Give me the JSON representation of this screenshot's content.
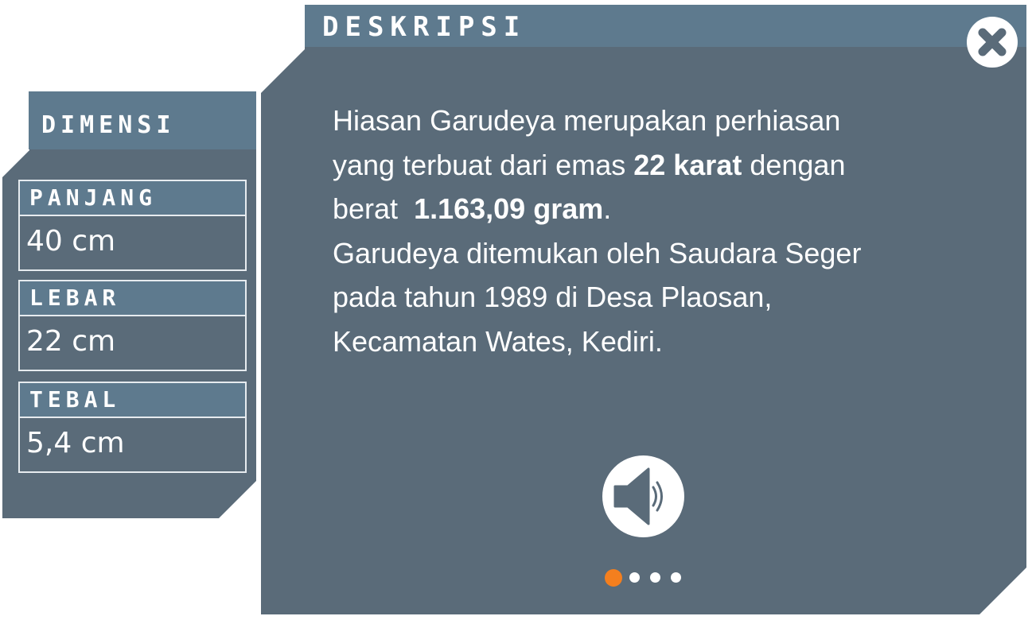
{
  "dimension": {
    "title": "DIMENSI",
    "items": [
      {
        "label": "PANJANG",
        "value": "40 cm"
      },
      {
        "label": "LEBAR",
        "value": "22 cm"
      },
      {
        "label": "TEBAL",
        "value": "5,4 cm"
      }
    ]
  },
  "description": {
    "title": "DESKRIPSI",
    "line1": "Hiasan Garudeya merupakan perhiasan",
    "line2_pre": "yang terbuat dari emas ",
    "line2_bold": "22 karat",
    "line2_post": " dengan",
    "line3_pre": "berat  ",
    "line3_bold": "1.163,09 gram",
    "line3_post": ".",
    "line4": "Garudeya ditemukan oleh Saudara Seger",
    "line5": "pada tahun 1989 di Desa Plaosan,",
    "line6": "Kecamatan Wates, Kediri."
  },
  "controls": {
    "close_icon": "close-icon",
    "audio_icon": "speaker-icon"
  },
  "pager": {
    "total": 4,
    "active_index": 0
  },
  "colors": {
    "panel": "#5a6b79",
    "header": "#5e7a8e",
    "accent": "#f47f1e",
    "text": "#ffffff"
  }
}
